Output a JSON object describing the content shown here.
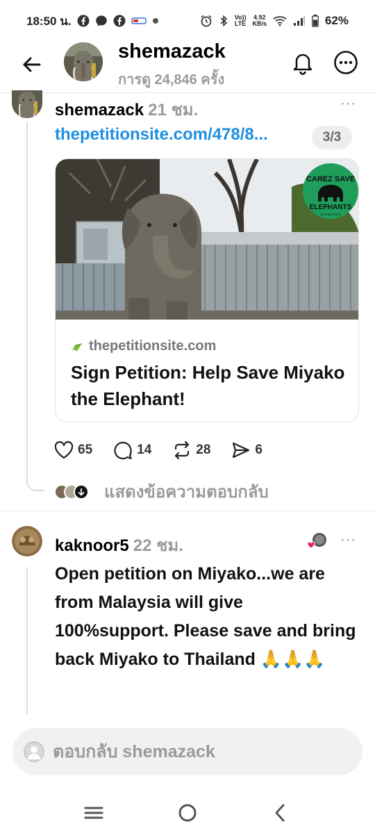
{
  "status_bar": {
    "time": "18:50 น.",
    "volte_top": "Vo))",
    "volte_bottom": "LTE",
    "speed_top": "4.92",
    "speed_bottom": "KB/s",
    "battery": "62%"
  },
  "header": {
    "username": "shemazack",
    "views": "การดู 24,846 ครั้ง"
  },
  "post": {
    "username": "shemazack",
    "time": "21 ชม.",
    "more": "···",
    "link": "thepetitionsite.com/478/8...",
    "counter": "3/3",
    "card": {
      "badge_top": "CAREZ SAVE",
      "badge_bottom": "ELEPHANTS",
      "badge_date": "OCTOBER 2019",
      "domain": "thepetitionsite.com",
      "title": "Sign Petition: Help Save Miyako the Elephant!"
    },
    "actions": {
      "likes": "65",
      "comments": "14",
      "reposts": "28",
      "shares": "6"
    },
    "show_replies": "แสดงข้อความตอบกลับ"
  },
  "reply": {
    "username": "kaknoor5",
    "time": "22 ชม.",
    "more": "···",
    "text": "Open petition on Miyako...we are from Malaysia will give 100%support. Please save and bring back Miyako to Thailand 🙏🙏🙏"
  },
  "composer": {
    "placeholder": "ตอบกลับ shemazack"
  },
  "colors": {
    "link": "#1d8fe0",
    "muted": "#9a9a9a",
    "like_heart": "#e0245e"
  }
}
